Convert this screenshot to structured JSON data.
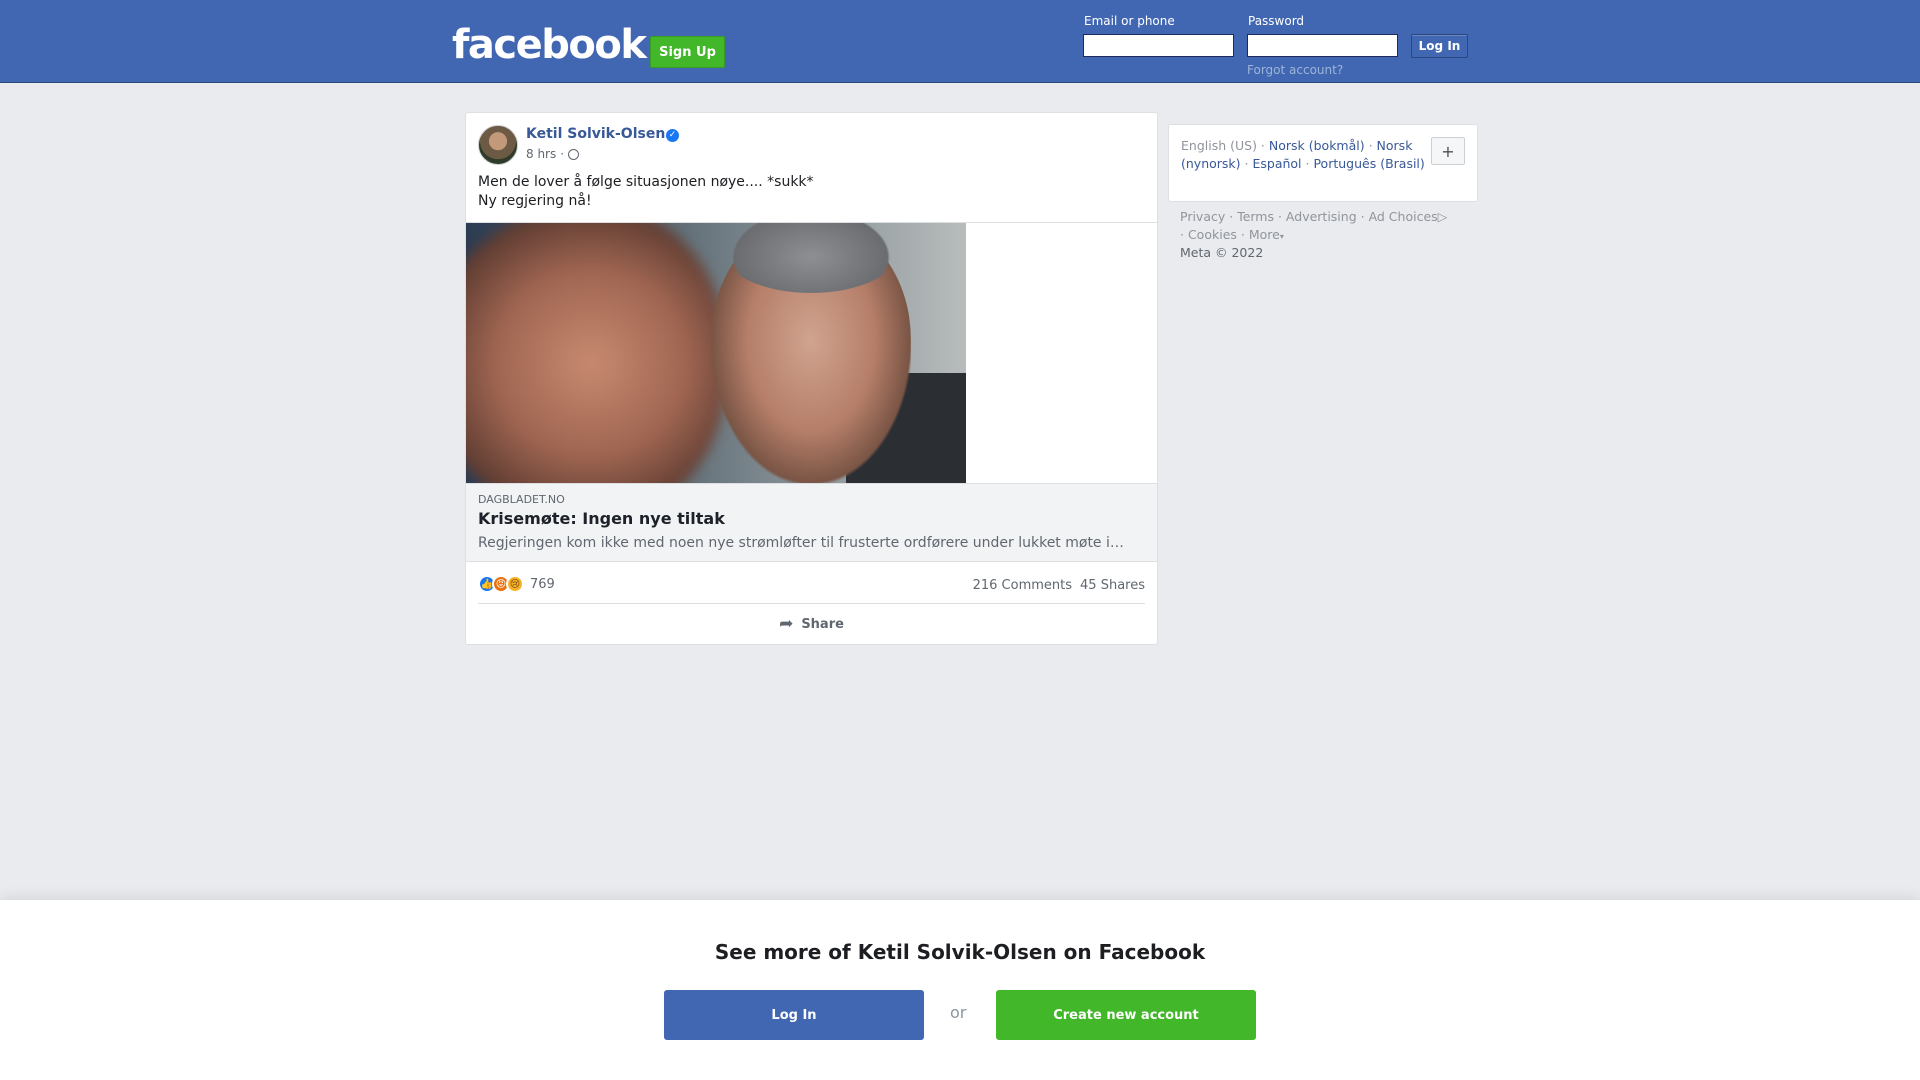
{
  "header": {
    "logo_text": "facebook",
    "signup_label": "Sign Up",
    "email_label": "Email or phone",
    "email_value": "",
    "password_label": "Password",
    "password_value": "",
    "login_label": "Log In",
    "forgot_label": "Forgot account?"
  },
  "post": {
    "author": "Ketil Solvik-Olsen",
    "verified": true,
    "time": "8 hrs",
    "separator": "·",
    "text_line1": "Men de lover å følge situasjonen nøye.... *sukk*",
    "text_line2": "Ny regjering nå!",
    "link": {
      "domain": "DAGBLADET.NO",
      "title": "Krisemøte: Ingen nye tiltak",
      "description": "Regjeringen kom ikke med noen nye strømløfter til frusterte ordførere under lukket møte i…"
    },
    "reactions": {
      "icons": [
        "like-icon",
        "angry-icon",
        "sad-icon"
      ],
      "count": "769"
    },
    "comments": "216 Comments",
    "shares": "45 Shares",
    "share_label": "Share"
  },
  "sidebar": {
    "languages": {
      "current": "English (US)",
      "others": [
        "Norsk (bokmål)",
        "Norsk (nynorsk)",
        "Español",
        "Português (Brasil)"
      ]
    },
    "footer_links": [
      "Privacy",
      "Terms",
      "Advertising",
      "Ad Choices",
      "Cookies",
      "More"
    ],
    "copyright": "Meta © 2022"
  },
  "bottom_prompt": {
    "title": "See more of Ketil Solvik-Olsen on Facebook",
    "login_label": "Log In",
    "or_label": "or",
    "create_label": "Create new account"
  },
  "colors": {
    "brand_blue": "#4267b2",
    "brand_green": "#42b72a",
    "link_blue": "#385898",
    "background": "#e9ebee"
  }
}
